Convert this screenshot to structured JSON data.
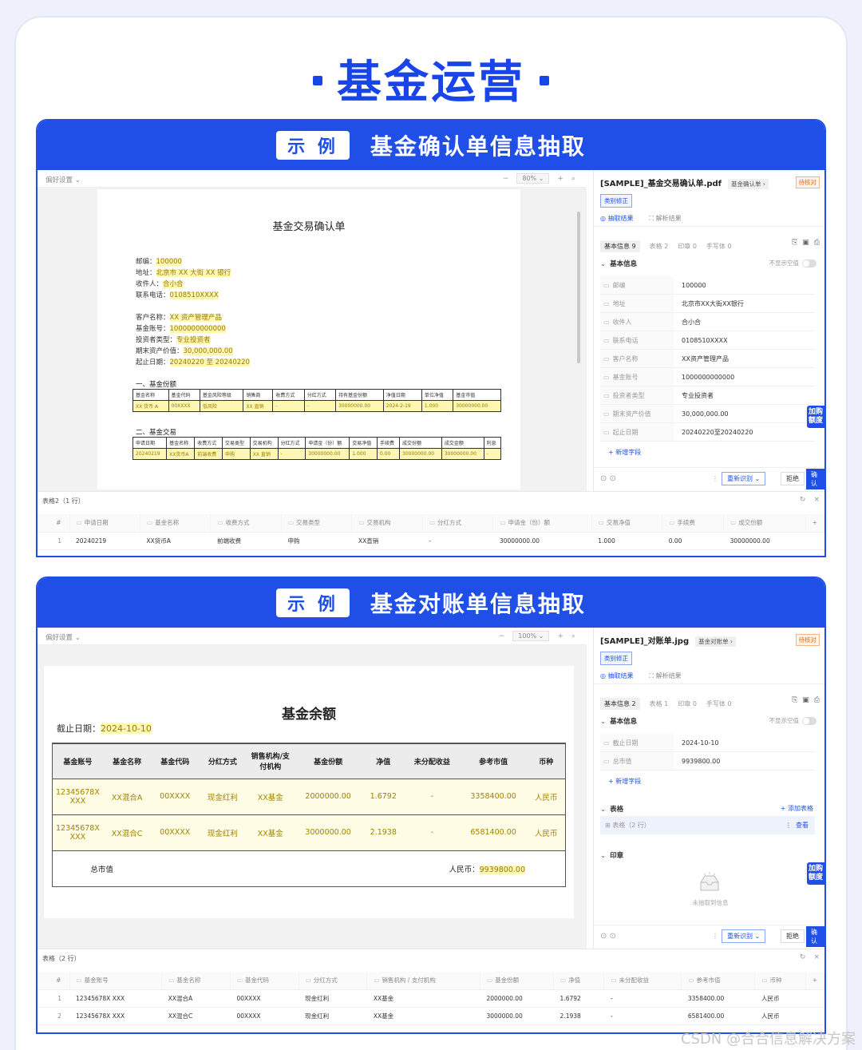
{
  "page": {
    "title": "基金运营",
    "watermark": "CSDN @合合信息解决方案"
  },
  "card1": {
    "badge": "示 例",
    "title": "基金确认单信息抽取",
    "toolbar": {
      "pref": "偏好设置 ⌄",
      "zoom": "80% ⌄"
    },
    "doc": {
      "title": "基金交易确认单",
      "lines1": [
        {
          "k": "邮编：",
          "v": "100000"
        },
        {
          "k": "地址：",
          "v": "北京市 XX 大街 XX 银行"
        },
        {
          "k": "收件人：",
          "v": "合小合"
        },
        {
          "k": "联系电话：",
          "v": "0108510XXXX"
        }
      ],
      "lines2": [
        {
          "k": "客户名称：",
          "v": "XX 资产管理产品"
        },
        {
          "k": "基金账号：",
          "v": "1000000000000"
        },
        {
          "k": "投资者类型：",
          "v": "专业投资者"
        },
        {
          "k": "期末资产价值：",
          "v": "30,000,000.00"
        },
        {
          "k": "起止日期：",
          "v": "20240220 至 20240220"
        }
      ],
      "sec1": "一、基金份额",
      "t1_head": [
        "基金名称",
        "基金代码",
        "基金风险等级",
        "销售商",
        "收费方式",
        "分红方式",
        "持有基金份额",
        "净值日期",
        "单位净值",
        "基金市值"
      ],
      "t1_row": [
        "XX 货币 A",
        "00XXXX",
        "低风险",
        "XX 直销",
        "-",
        "-",
        "30000000.00",
        "2024-2-19",
        "1.000",
        "30000000.00"
      ],
      "sec2": "二、基金交易",
      "t2_head": [
        "申请日期",
        "基金名称",
        "收费方式",
        "交易类型",
        "交易机构",
        "分红方式",
        "申请金（份）额",
        "交易净值",
        "手续费",
        "成交份额",
        "成交金额",
        "利息"
      ],
      "t2_row": [
        "20240219",
        "XX货币A",
        "前端收费",
        "申购",
        "XX 直销",
        "-",
        "30000000.00",
        "1.000",
        "0.00",
        "30000000.00",
        "30000000.00",
        "-"
      ]
    },
    "right": {
      "filename": "[SAMPLE]_基金交易确认单.pdf",
      "filetag": "基金确认单 ›",
      "status": "待核对",
      "fix": "类别修正",
      "tab_extract": "抽取结果",
      "tab_parse": "解析结果",
      "subtabs": [
        "基本信息 9",
        "表格 2",
        "印章 0",
        "手写体 0"
      ],
      "section": "基本信息",
      "hide_empty": "不显示空值",
      "fields": [
        {
          "label": "邮编",
          "value": "100000"
        },
        {
          "label": "地址",
          "value": "北京市XX大街XX银行"
        },
        {
          "label": "收件人",
          "value": "合小合"
        },
        {
          "label": "联系电话",
          "value": "0108510XXXX"
        },
        {
          "label": "客户名称",
          "value": "XX资产管理产品"
        },
        {
          "label": "基金账号",
          "value": "1000000000000"
        },
        {
          "label": "投资者类型",
          "value": "专业投资者"
        },
        {
          "label": "期末资产价值",
          "value": "30,000,000.00"
        },
        {
          "label": "起止日期",
          "value": "20240220至20240220"
        }
      ],
      "add_field": "+ 新增字段",
      "recognize": "重新识别 ⌄",
      "reject": "拒绝",
      "confirm": "确认",
      "side_tag": "加购额度"
    },
    "bottom": {
      "title": "表格2（1 行）",
      "headers": [
        "申请日期",
        "基金名称",
        "收费方式",
        "交易类型",
        "交易机构",
        "分红方式",
        "申请金（份）额",
        "交易净值",
        "手续费",
        "成交份额"
      ],
      "rows": [
        [
          "1",
          "20240219",
          "XX货币A",
          "前端收费",
          "申购",
          "XX直销",
          "-",
          "30000000.00",
          "1.000",
          "0.00",
          "30000000.00"
        ]
      ]
    }
  },
  "card2": {
    "badge": "示 例",
    "title": "基金对账单信息抽取",
    "toolbar": {
      "pref": "偏好设置 ⌄",
      "zoom": "100% ⌄"
    },
    "doc": {
      "title": "基金余额",
      "date_label": "截止日期：",
      "date_value": "2024-10-10",
      "head": [
        "基金账号",
        "基金名称",
        "基金代码",
        "分红方式",
        "销售机构/支付机构",
        "基金份额",
        "净值",
        "未分配收益",
        "参考市值",
        "币种"
      ],
      "rows": [
        [
          "12345678X XXX",
          "XX混合A",
          "00XXXX",
          "现金红利",
          "XX基金",
          "2000000.00",
          "1.6792",
          "-",
          "3358400.00",
          "人民币"
        ],
        [
          "12345678X XXX",
          "XX混合C",
          "00XXXX",
          "现金红利",
          "XX基金",
          "3000000.00",
          "2.1938",
          "-",
          "6581400.00",
          "人民币"
        ]
      ],
      "total_label": "总市值",
      "total_cur": "人民币：",
      "total_value": "9939800.00"
    },
    "right": {
      "filename": "[SAMPLE]_对账单.jpg",
      "filetag": "基金对账单 ›",
      "status": "待核对",
      "fix": "类别修正",
      "tab_extract": "抽取结果",
      "tab_parse": "解析结果",
      "subtabs": [
        "基本信息 2",
        "表格 1",
        "印章 0",
        "手写体 0"
      ],
      "section": "基本信息",
      "hide_empty": "不显示空值",
      "fields": [
        {
          "label": "截止日期",
          "value": "2024-10-10"
        },
        {
          "label": "总市值",
          "value": "9939800.00"
        }
      ],
      "add_field": "+ 新增字段",
      "table_section": "表格",
      "add_table": "+ 添加表格",
      "table_item": "表格（2 行）",
      "view": "查看",
      "stamp_section": "印章",
      "no_stamp": "未抽取到信息",
      "recognize": "重新识别 ⌄",
      "reject": "拒绝",
      "confirm": "确认",
      "side_tag": "加购额度"
    },
    "bottom": {
      "title": "表格（2 行）",
      "headers": [
        "基金账号",
        "基金名称",
        "基金代码",
        "分红方式",
        "销售机构 / 支付机构",
        "基金份额",
        "净值",
        "未分配收益",
        "参考市值",
        "币种"
      ],
      "rows": [
        [
          "1",
          "12345678X XXX",
          "XX混合A",
          "00XXXX",
          "现金红利",
          "XX基金",
          "2000000.00",
          "1.6792",
          "-",
          "3358400.00",
          "人民币"
        ],
        [
          "2",
          "12345678X XXX",
          "XX混合C",
          "00XXXX",
          "现金红利",
          "XX基金",
          "3000000.00",
          "2.1938",
          "-",
          "6581400.00",
          "人民币"
        ]
      ]
    }
  }
}
